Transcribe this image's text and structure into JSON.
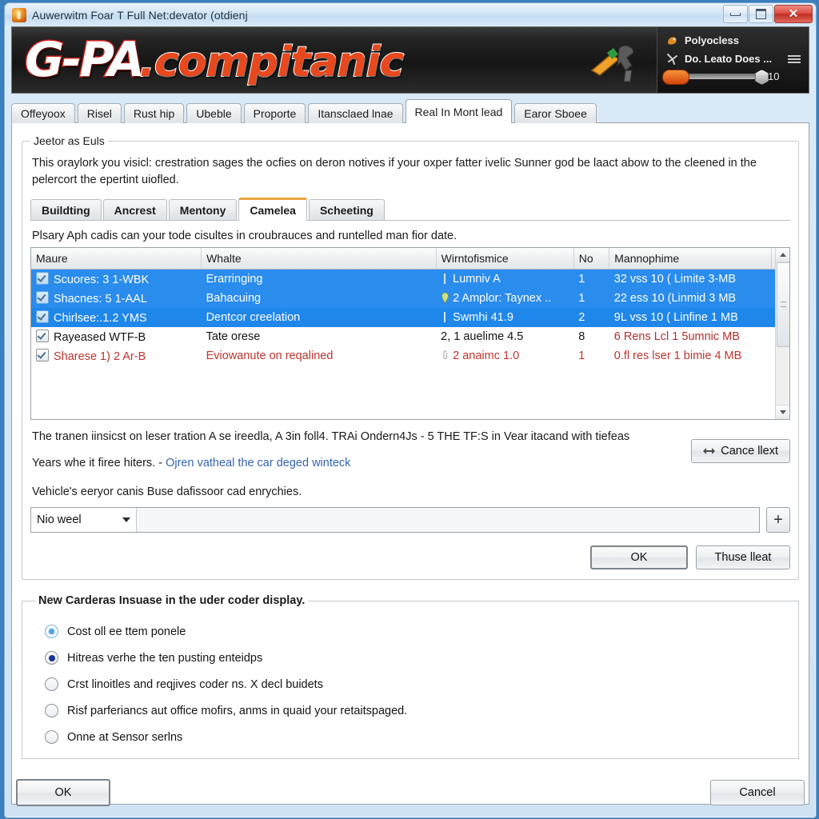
{
  "window": {
    "title": "Auwerwitm Foar T Full Net:devator (otdienj",
    "icon": "app-flame-icon",
    "controls": {
      "minimize": "minimize",
      "maximize": "maximize",
      "close": "close"
    }
  },
  "brand": {
    "logo_part1": "G-PA",
    "logo_part2": ".compitanic",
    "tool_icon": "wrench-screwdriver-icon",
    "panel": {
      "line1_label": "Polyocless",
      "line1_icon": "user-head-icon",
      "line2_label": "Do. Leato Does ...",
      "line2_icon": "runner-icon",
      "menu_icon": "list-menu-icon",
      "slider_value": "10"
    }
  },
  "tabs": [
    {
      "label": "Offeyoox",
      "active": false
    },
    {
      "label": "Risel",
      "active": false
    },
    {
      "label": "Rust hip",
      "active": false
    },
    {
      "label": "Ubeble",
      "active": false
    },
    {
      "label": "Proporte",
      "active": false
    },
    {
      "label": "Itansclaed lnae",
      "active": false
    },
    {
      "label": "Real In Mont lead",
      "active": true
    },
    {
      "label": "Earor Sboee",
      "active": false
    }
  ],
  "group": {
    "legend": "Jeetor as Euls",
    "description": "This oraylork you visicl: crestration sages the ocfies on deron notives if your oxper fatter ivelic Sunner god be laact abow to the cleened in the pelercort the epertint uiofled."
  },
  "inner_tabs": [
    {
      "label": "Buildting",
      "active": false
    },
    {
      "label": "Ancrest",
      "active": false
    },
    {
      "label": "Mentony",
      "active": false
    },
    {
      "label": "Camelea",
      "active": true
    },
    {
      "label": "Scheeting",
      "active": false
    }
  ],
  "table": {
    "hint": "Plsary Aph cadis can your tode cisultes in croubrauces and runtelled man fior date.",
    "columns": [
      "Maure",
      "Whalte",
      "Wirntofismice",
      "No",
      "Mannophime",
      "!"
    ],
    "rows": [
      {
        "name": "Scuores: 3 1-WBK",
        "state": "Erarringing",
        "info": "Lumniv A",
        "no": "1",
        "size": "32 vss 10 ( Limite 3-MB",
        "style": "selected",
        "icon": "checkbox-icon",
        "info_icon": "bar-icon"
      },
      {
        "name": "Shacnes: 5 1-AAL",
        "state": "Bahacuing",
        "info": "2 Amplor: Taynex ..",
        "no": "1",
        "size": "22 ess 10 (Linmid 3 MB",
        "style": "selected",
        "icon": "checkbox-icon",
        "info_icon": "pin-icon"
      },
      {
        "name": "Chirlsee:.1.2 YMS",
        "state": "Dentcor creelation",
        "info": "Swmhi 41.9",
        "no": "2",
        "size": "9L vss 10 ( Linfine 1 MB",
        "style": "selected",
        "icon": "checkbox-icon",
        "info_icon": "bar-icon"
      },
      {
        "name": "Rayeased WTF-B",
        "state": "Tate orese",
        "info": "2, 1 auelime 4.5",
        "no": "8",
        "size": "6 Rens Lcl 1 5umnic MB",
        "style": "warn",
        "icon": "checkbox-icon",
        "info_icon": ""
      },
      {
        "name": "Sharese 1) 2 Ar-B",
        "state": "Eviowanute on reqalined",
        "info": "2 anaimc 1.0",
        "no": "1",
        "size": "0.fl res lser 1 bimie 4 MB",
        "style": "alert",
        "icon": "checkbox-icon",
        "info_icon": "clip-icon"
      }
    ],
    "scroll": {
      "up_icon": "chevron-up-icon",
      "down_icon": "chevron-down-icon"
    }
  },
  "below_table": {
    "note_line1": "The tranen iinsicst on leser tration A se ireedla, A 3in foll4. TRAi Ondern4Js - 5 THE TF:S in Vear itacand with tiefeas",
    "note_line2_prefix": "Years whe it firee hiters. -",
    "note_link": "Ojren vatheal the car deged winteck",
    "cancel_next_button": "Cance llext",
    "cancel_next_icon": "arrows-left-right-icon"
  },
  "selector": {
    "label": "Vehicle's eeryor canis Buse dafissoor cad enrychies.",
    "combo_value": "Nio weel",
    "add_button": "+",
    "caret_icon": "caret-down-icon"
  },
  "action_buttons": {
    "ok": "OK",
    "secondary": "Thuse lleat"
  },
  "radio_group": {
    "legend": "New Carderas Insuase in the uder coder display.",
    "options": [
      {
        "label": "Cost oll ee ttem ponele",
        "state": "hover"
      },
      {
        "label": "Hitreas verhe the ten pusting enteidps",
        "state": "selected"
      },
      {
        "label": "Crst linoitles and reqjives coder ns. X decl buidets",
        "state": "off"
      },
      {
        "label": "Risf parferiancs aut office mofirs, anms in quaid your retaitspaged.",
        "state": "off"
      },
      {
        "label": "Onne at Sensor serlns",
        "state": "off"
      }
    ]
  },
  "footer": {
    "ok": "OK",
    "cancel": "Cancel"
  },
  "colors": {
    "selection_blue": "#2a8cec",
    "accent_orange": "#e8a33d",
    "warn_red": "#b3302c",
    "link_blue": "#3465b0",
    "logo_red": "#cf2019",
    "logo_orange": "#e8481d"
  }
}
